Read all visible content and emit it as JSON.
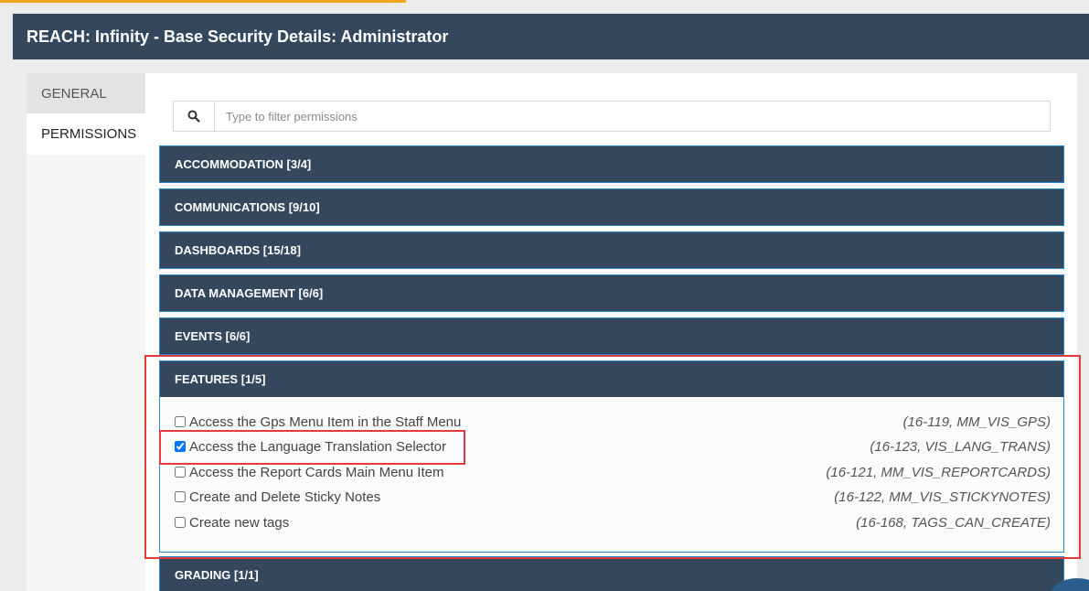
{
  "header": {
    "title": "REACH: Infinity - Base Security Details: Administrator"
  },
  "tabs": [
    {
      "label": "GENERAL"
    },
    {
      "label": "PERMISSIONS"
    }
  ],
  "search": {
    "placeholder": "Type to filter permissions",
    "icon": "search-icon"
  },
  "categories": [
    {
      "label": "ACCOMMODATION [3/4]"
    },
    {
      "label": "COMMUNICATIONS [9/10]"
    },
    {
      "label": "DASHBOARDS [15/18]"
    },
    {
      "label": "DATA MANAGEMENT [6/6]"
    },
    {
      "label": "EVENTS [6/6]"
    },
    {
      "label": "FEATURES [1/5]"
    },
    {
      "label": "GRADING [1/1]"
    }
  ],
  "features": [
    {
      "label": "Access the Gps Menu Item in the Staff Menu",
      "code": "(16-119, MM_VIS_GPS)",
      "checked": false
    },
    {
      "label": "Access the Language Translation Selector",
      "code": "(16-123, VIS_LANG_TRANS)",
      "checked": true
    },
    {
      "label": "Access the Report Cards Main Menu Item",
      "code": "(16-121, MM_VIS_REPORTCARDS)",
      "checked": false
    },
    {
      "label": "Create and Delete Sticky Notes",
      "code": "(16-122, MM_VIS_STICKYNOTES)",
      "checked": false
    },
    {
      "label": "Create new tags",
      "code": "(16-168, TAGS_CAN_CREATE)",
      "checked": false
    }
  ],
  "colors": {
    "header_bg": "#34475c",
    "accent": "#f0a51e",
    "highlight": "#e03c3c",
    "border": "#2a86c9"
  }
}
